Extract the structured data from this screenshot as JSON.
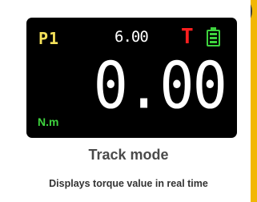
{
  "display": {
    "preset": "P1",
    "setpoint": "6.00",
    "mode_flag": "T",
    "battery_level": "full",
    "reading": "0.00",
    "unit": "N.m"
  },
  "caption": {
    "title": "Track mode",
    "description": "Displays torque value in real time"
  },
  "colors": {
    "preset": "#f5e15a",
    "mode_flag": "#ff1f1f",
    "battery": "#3ed33e",
    "unit": "#3ed33e",
    "screen_background": "#000000",
    "frame_accent": "#f2b705"
  },
  "icons": {
    "battery": "battery-full-icon"
  }
}
